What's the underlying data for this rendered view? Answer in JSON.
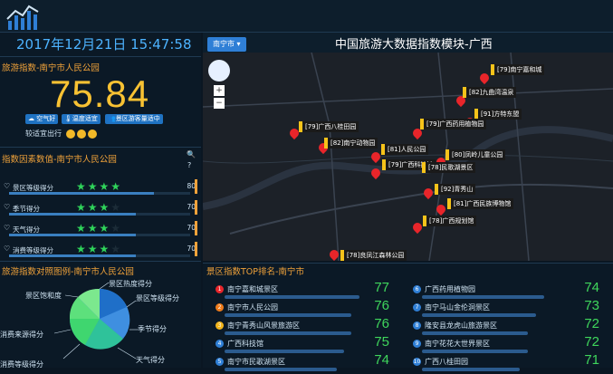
{
  "header": {
    "datetime": "2017年12月21日  15:47:58"
  },
  "index_panel": {
    "title": "旅游指数-南宁市人民公园",
    "value": "75.84",
    "tags": [
      "空气好",
      "温度适宜",
      "景区游客量适中"
    ],
    "trip_label": "较适宜出行"
  },
  "factor_panel": {
    "title": "指数因素数值-南宁市人民公园",
    "help": "?",
    "items": [
      {
        "label": "景区等级得分",
        "stars": 4,
        "value": "80",
        "fill": 0.8
      },
      {
        "label": "季节得分",
        "stars": 3,
        "value": "70",
        "fill": 0.7
      },
      {
        "label": "天气得分",
        "stars": 3,
        "value": "70",
        "fill": 0.7
      },
      {
        "label": "消费等级得分",
        "stars": 3,
        "value": "70",
        "fill": 0.7
      }
    ]
  },
  "chart_panel": {
    "title": "旅游指数对照图例-南宁市人民公园",
    "labels": [
      "景区热度得分",
      "景区等级得分",
      "季节得分",
      "天气得分",
      "消费等级得分",
      "消费来源得分",
      "景区饱和度"
    ]
  },
  "map": {
    "title": "中国旅游大数据指数模块-广西",
    "city": "南宁市",
    "zoom_in": "+",
    "zoom_out": "−",
    "pois": [
      "[79]南宁嘉和城",
      "[82]九曲湾温泉",
      "[91]方特东盟",
      "[79]广西药用植物园",
      "[79]广西八桂田园",
      "[82]南宁动物园",
      "[81]人民公园",
      "[80]凤岭儿童公园",
      "[79]广西科技馆",
      "[78]民歌湖景区",
      "[92]青秀山",
      "[81]广西民族博物馆",
      "[78]广西规划馆",
      "[78]良凤江森林公园"
    ]
  },
  "ranking": {
    "title": "景区指数TOP排名-南宁市",
    "left": [
      {
        "rank": "1",
        "name": "南宁嘉和城景区",
        "score": "77",
        "color": "#e8252a",
        "fill": 0.9
      },
      {
        "rank": "2",
        "name": "南宁市人民公园",
        "score": "76",
        "color": "#ef7b1a",
        "fill": 0.85
      },
      {
        "rank": "3",
        "name": "南宁青秀山风景旅游区",
        "score": "76",
        "color": "#f2b51c",
        "fill": 0.85
      },
      {
        "rank": "4",
        "name": "广西科技馆",
        "score": "75",
        "color": "#2f7fd6",
        "fill": 0.8
      },
      {
        "rank": "5",
        "name": "南宁市民歌湖景区",
        "score": "74",
        "color": "#2f7fd6",
        "fill": 0.75
      }
    ],
    "right": [
      {
        "rank": "6",
        "name": "广西药用植物园",
        "score": "74",
        "color": "#2f7fd6",
        "fill": 0.75
      },
      {
        "rank": "7",
        "name": "南宁马山金伦洞景区",
        "score": "73",
        "color": "#2f7fd6",
        "fill": 0.7
      },
      {
        "rank": "8",
        "name": "隆安县龙虎山旅游景区",
        "score": "72",
        "color": "#2f7fd6",
        "fill": 0.65
      },
      {
        "rank": "9",
        "name": "南宁花花大世界景区",
        "score": "72",
        "color": "#2f7fd6",
        "fill": 0.65
      },
      {
        "rank": "10",
        "name": "广西八桂田园",
        "score": "71",
        "color": "#2f7fd6",
        "fill": 0.6
      }
    ]
  }
}
